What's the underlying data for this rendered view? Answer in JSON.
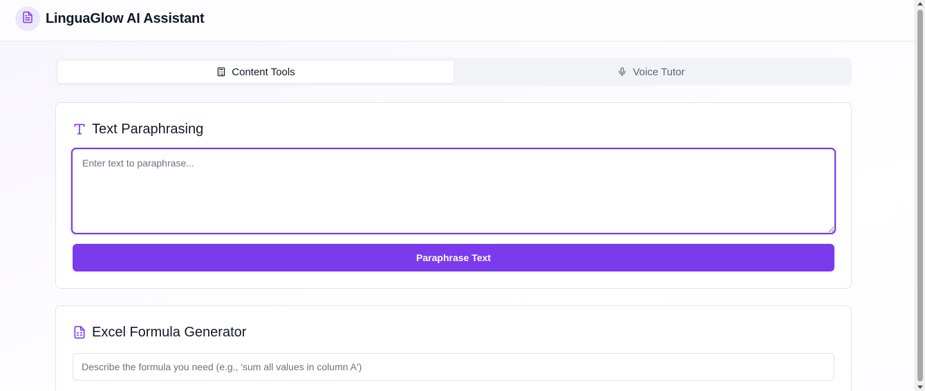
{
  "app": {
    "title": "LinguaGlow AI Assistant",
    "logo_icon": "document-icon",
    "accent_color": "#7c3aed"
  },
  "tabs": [
    {
      "label": "Content Tools",
      "icon": "calculator-icon",
      "active": true
    },
    {
      "label": "Voice Tutor",
      "icon": "microphone-icon",
      "active": false
    }
  ],
  "paraphrase": {
    "title": "Text Paraphrasing",
    "icon": "type-icon",
    "placeholder": "Enter text to paraphrase...",
    "value": "",
    "button_label": "Paraphrase Text"
  },
  "excel": {
    "title": "Excel Formula Generator",
    "icon": "spreadsheet-icon",
    "placeholder": "Describe the formula you need (e.g., 'sum all values in column A')",
    "value": ""
  }
}
